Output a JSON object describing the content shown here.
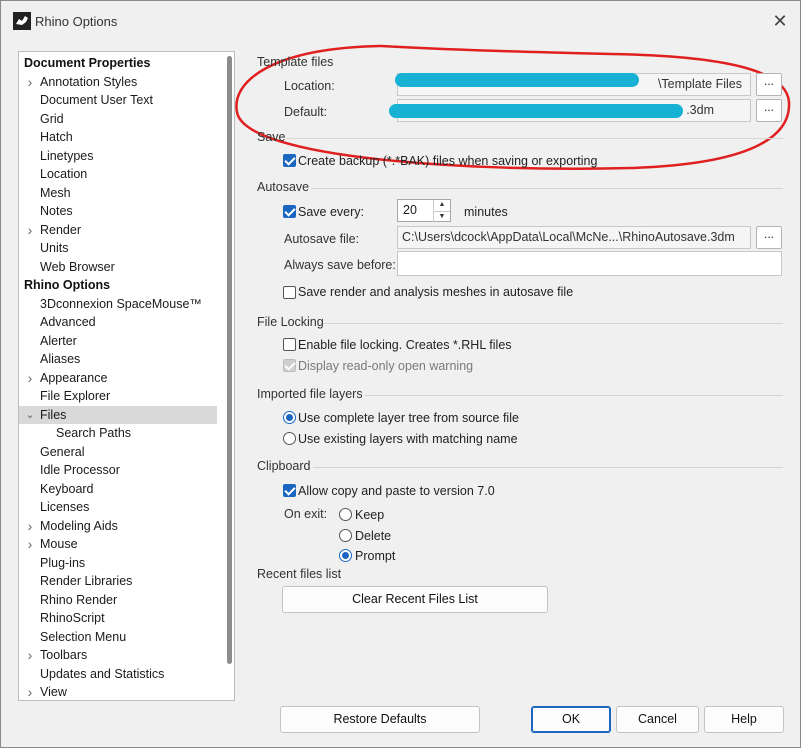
{
  "window": {
    "title": "Rhino Options",
    "close_glyph": "✕"
  },
  "tree": {
    "items": [
      {
        "label": "Document Properties",
        "kind": "header",
        "indent": 0
      },
      {
        "label": "Annotation Styles",
        "kind": "item",
        "indent": 1,
        "expandable": true
      },
      {
        "label": "Document User Text",
        "kind": "item",
        "indent": 1
      },
      {
        "label": "Grid",
        "kind": "item",
        "indent": 1
      },
      {
        "label": "Hatch",
        "kind": "item",
        "indent": 1
      },
      {
        "label": "Linetypes",
        "kind": "item",
        "indent": 1
      },
      {
        "label": "Location",
        "kind": "item",
        "indent": 1
      },
      {
        "label": "Mesh",
        "kind": "item",
        "indent": 1
      },
      {
        "label": "Notes",
        "kind": "item",
        "indent": 1
      },
      {
        "label": "Render",
        "kind": "item",
        "indent": 1,
        "expandable": true
      },
      {
        "label": "Units",
        "kind": "item",
        "indent": 1
      },
      {
        "label": "Web Browser",
        "kind": "item",
        "indent": 1
      },
      {
        "label": "Rhino Options",
        "kind": "header",
        "indent": 0
      },
      {
        "label": "3Dconnexion SpaceMouse™",
        "kind": "item",
        "indent": 1
      },
      {
        "label": "Advanced",
        "kind": "item",
        "indent": 1
      },
      {
        "label": "Alerter",
        "kind": "item",
        "indent": 1
      },
      {
        "label": "Aliases",
        "kind": "item",
        "indent": 1
      },
      {
        "label": "Appearance",
        "kind": "item",
        "indent": 1,
        "expandable": true
      },
      {
        "label": "File Explorer",
        "kind": "item",
        "indent": 1
      },
      {
        "label": "Files",
        "kind": "item",
        "indent": 1,
        "expanded": true,
        "selected": true
      },
      {
        "label": "Search Paths",
        "kind": "item",
        "indent": 2
      },
      {
        "label": "General",
        "kind": "item",
        "indent": 1
      },
      {
        "label": "Idle Processor",
        "kind": "item",
        "indent": 1
      },
      {
        "label": "Keyboard",
        "kind": "item",
        "indent": 1
      },
      {
        "label": "Licenses",
        "kind": "item",
        "indent": 1
      },
      {
        "label": "Modeling Aids",
        "kind": "item",
        "indent": 1,
        "expandable": true
      },
      {
        "label": "Mouse",
        "kind": "item",
        "indent": 1,
        "expandable": true
      },
      {
        "label": "Plug-ins",
        "kind": "item",
        "indent": 1
      },
      {
        "label": "Render Libraries",
        "kind": "item",
        "indent": 1
      },
      {
        "label": "Rhino Render",
        "kind": "item",
        "indent": 1
      },
      {
        "label": "RhinoScript",
        "kind": "item",
        "indent": 1
      },
      {
        "label": "Selection Menu",
        "kind": "item",
        "indent": 1
      },
      {
        "label": "Toolbars",
        "kind": "item",
        "indent": 1,
        "expandable": true
      },
      {
        "label": "Updates and Statistics",
        "kind": "item",
        "indent": 1
      },
      {
        "label": "View",
        "kind": "item",
        "indent": 1,
        "expandable": true
      }
    ]
  },
  "template": {
    "section": "Template files",
    "location_label": "Location:",
    "location_value": "\\Template Files",
    "default_label": "Default:",
    "default_value": ".3dm",
    "browse": "..."
  },
  "save": {
    "section": "Save",
    "backup_label": "Create backup (*.*BAK) files when saving or exporting",
    "backup_checked": true
  },
  "autosave": {
    "section": "Autosave",
    "save_every_label": "Save every:",
    "save_every_checked": true,
    "minutes_value": "20",
    "minutes_label": "minutes",
    "file_label": "Autosave file:",
    "file_value": "C:\\Users\\dcock\\AppData\\Local\\McNe...\\RhinoAutosave.3dm",
    "browse": "...",
    "always_save_label": "Always save before:",
    "always_save_value": "",
    "meshes_label": "Save render and analysis meshes in autosave file",
    "meshes_checked": false
  },
  "locking": {
    "section": "File Locking",
    "enable_label": "Enable file locking. Creates *.RHL files",
    "enable_checked": false,
    "readonly_label": "Display read-only open warning",
    "readonly_checked": true,
    "readonly_disabled": true
  },
  "layers": {
    "section": "Imported file layers",
    "opt_complete": "Use complete layer tree from source file",
    "opt_existing": "Use existing layers with matching name",
    "selected": "complete"
  },
  "clipboard": {
    "section": "Clipboard",
    "allow_label": "Allow copy and paste to version 7.0",
    "allow_checked": true,
    "on_exit_label": "On exit:",
    "opt_keep": "Keep",
    "opt_delete": "Delete",
    "opt_prompt": "Prompt",
    "selected": "prompt"
  },
  "recent": {
    "section": "Recent files list",
    "clear_button": "Clear Recent Files List"
  },
  "footer": {
    "restore": "Restore Defaults",
    "ok": "OK",
    "cancel": "Cancel",
    "help": "Help"
  },
  "colors": {
    "accent": "#1a66c0",
    "annotation_red": "#e02020",
    "redaction_cyan": "#17b1d4"
  }
}
